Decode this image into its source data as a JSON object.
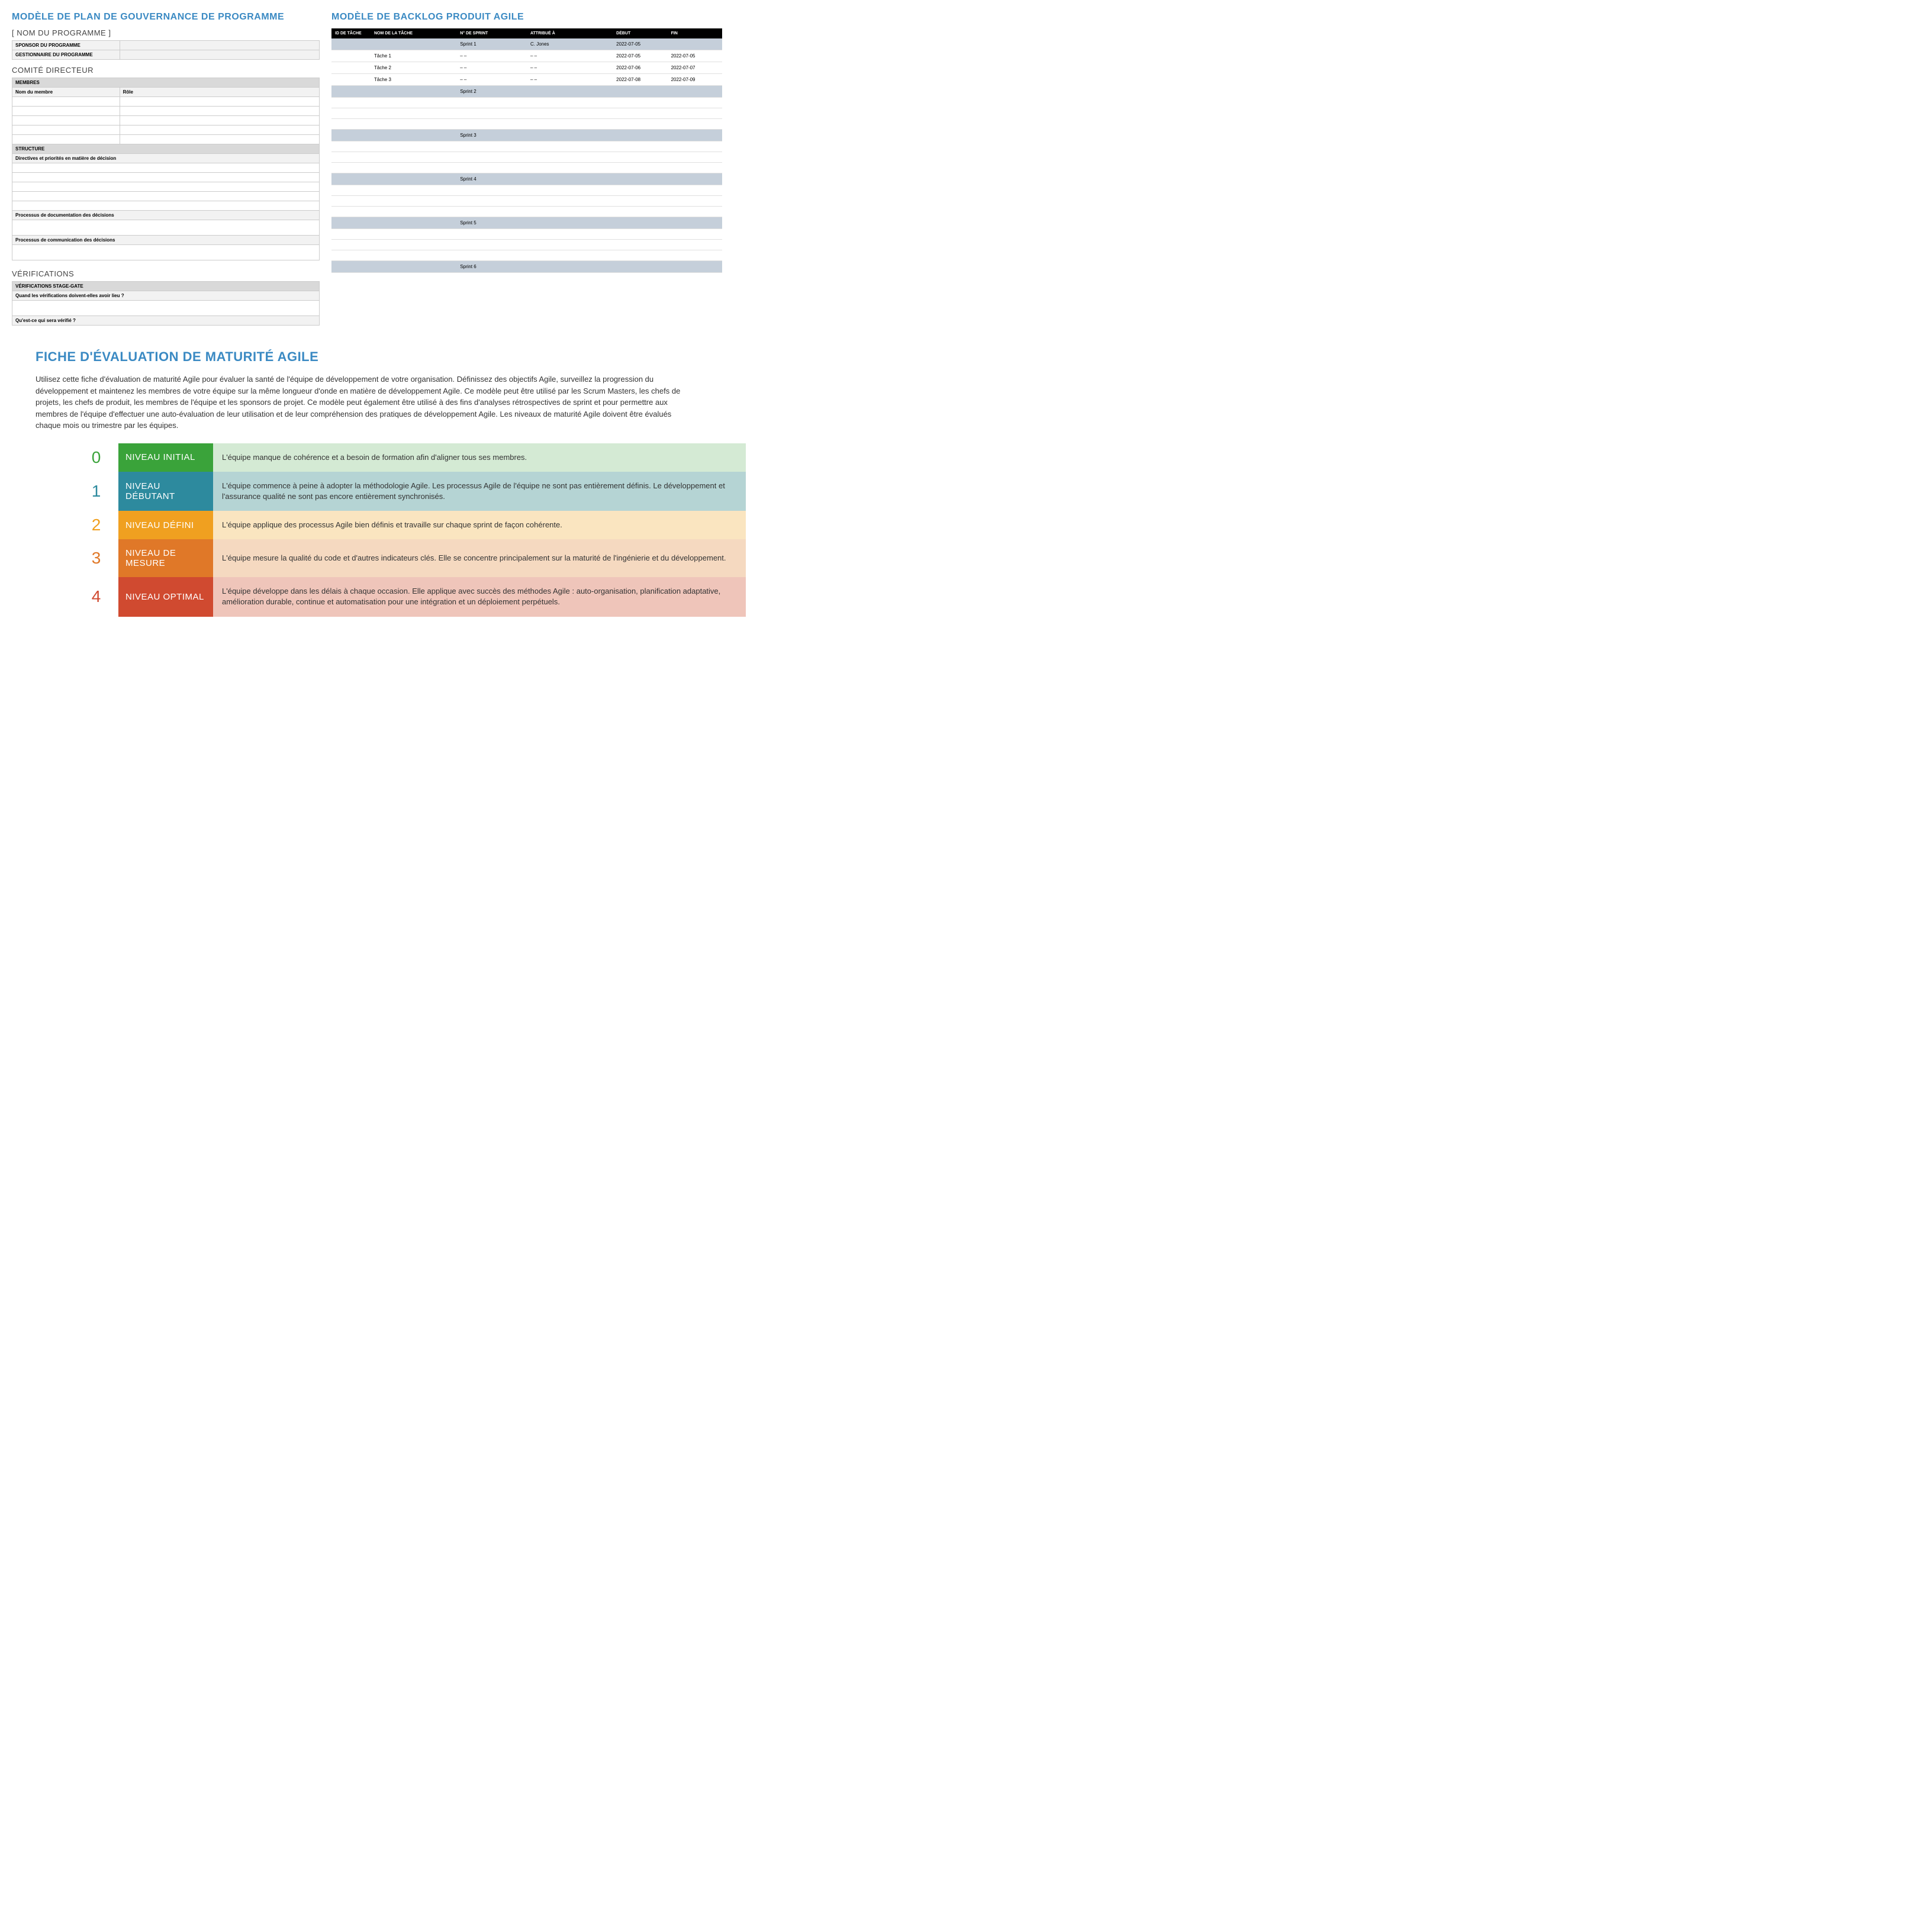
{
  "governance": {
    "title": "MODÈLE DE PLAN DE GOUVERNANCE DE PROGRAMME",
    "program_name": "[ NOM DU PROGRAMME ]",
    "sponsor_label": "SPONSOR DU PROGRAMME",
    "manager_label": "GESTIONNAIRE DU PROGRAMME",
    "committee_title": "COMITÉ DIRECTEUR",
    "members_label": "MEMBRES",
    "member_name_col": "Nom du membre",
    "role_col": "Rôle",
    "structure_label": "STRUCTURE",
    "decision_directives": "Directives et priorités en matière de décision",
    "doc_process": "Processus de documentation des décisions",
    "comm_process": "Processus de communication des décisions",
    "verifications_title": "VÉRIFICATIONS",
    "stage_gate_label": "VÉRIFICATIONS STAGE-GATE",
    "when_verif": "Quand les vérifications doivent-elles avoir lieu ?",
    "what_verif": "Qu'est-ce qui sera vérifié ?"
  },
  "backlog": {
    "title": "MODÈLE DE BACKLOG PRODUIT AGILE",
    "headers": {
      "task_id": "ID DE TÂCHE",
      "task_name": "NOM DE LA TÂCHE",
      "sprint_no": "N° DE SPRINT",
      "assigned": "ATTRIBUÉ À",
      "start": "DÉBUT",
      "end": "FIN"
    },
    "rows": [
      {
        "type": "sprint",
        "sprint": "Sprint 1",
        "assigned": "C. Jones",
        "start": "2022-07-05",
        "end": ""
      },
      {
        "type": "task",
        "name": "Tâche 1",
        "sprint": "– –",
        "assigned": "– –",
        "start": "2022-07-05",
        "end": "2022-07-05"
      },
      {
        "type": "task",
        "name": "Tâche 2",
        "sprint": "– –",
        "assigned": "– –",
        "start": "2022-07-06",
        "end": "2022-07-07"
      },
      {
        "type": "task",
        "name": "Tâche 3",
        "sprint": "– –",
        "assigned": "– –",
        "start": "2022-07-08",
        "end": "2022-07-09"
      },
      {
        "type": "sprint",
        "sprint": "Sprint 2"
      },
      {
        "type": "task"
      },
      {
        "type": "task"
      },
      {
        "type": "task"
      },
      {
        "type": "sprint",
        "sprint": "Sprint 3"
      },
      {
        "type": "task"
      },
      {
        "type": "task"
      },
      {
        "type": "task"
      },
      {
        "type": "sprint",
        "sprint": "Sprint 4"
      },
      {
        "type": "task"
      },
      {
        "type": "task"
      },
      {
        "type": "task"
      },
      {
        "type": "sprint",
        "sprint": "Sprint 5"
      },
      {
        "type": "task"
      },
      {
        "type": "task"
      },
      {
        "type": "task"
      },
      {
        "type": "sprint",
        "sprint": "Sprint 6"
      }
    ]
  },
  "maturity": {
    "title": "FICHE D'ÉVALUATION DE MATURITÉ AGILE",
    "description": "Utilisez cette fiche d'évaluation de maturité Agile pour évaluer la santé de l'équipe de développement de votre organisation.  Définissez des objectifs Agile, surveillez la progression du développement et maintenez les membres de votre équipe sur la même longueur d'onde en matière de développement Agile. Ce modèle peut être utilisé par les Scrum Masters, les chefs de projets, les chefs de produit, les membres de l'équipe et les sponsors de projet. Ce modèle peut également être utilisé à des fins d'analyses rétrospectives de sprint et pour permettre aux membres de l'équipe d'effectuer une auto-évaluation de leur utilisation et de leur compréhension des pratiques de développement Agile. Les niveaux de maturité Agile doivent être évalués chaque mois ou trimestre par les équipes.",
    "levels": [
      {
        "num": "0",
        "label": "NIVEAU INITIAL",
        "text": "L'équipe manque de cohérence et a besoin de formation afin d'aligner tous ses membres."
      },
      {
        "num": "1",
        "label": "NIVEAU DÉBUTANT",
        "text": "L'équipe commence à peine à adopter la méthodologie Agile. Les processus Agile de l'équipe ne sont pas entièrement définis. Le développement et l'assurance qualité ne sont pas encore entièrement synchronisés."
      },
      {
        "num": "2",
        "label": "NIVEAU DÉFINI",
        "text": "L'équipe applique des processus Agile bien définis et travaille sur chaque sprint de façon cohérente."
      },
      {
        "num": "3",
        "label": "NIVEAU DE MESURE",
        "text": "L'équipe mesure la qualité du code et d'autres indicateurs clés. Elle se concentre principalement sur la maturité de l'ingénierie et du développement."
      },
      {
        "num": "4",
        "label": "NIVEAU OPTIMAL",
        "text": "L'équipe développe dans les délais à chaque occasion. Elle applique avec succès des méthodes Agile : auto-organisation, planification adaptative, amélioration durable, continue et automatisation pour une intégration et un déploiement perpétuels."
      }
    ]
  }
}
